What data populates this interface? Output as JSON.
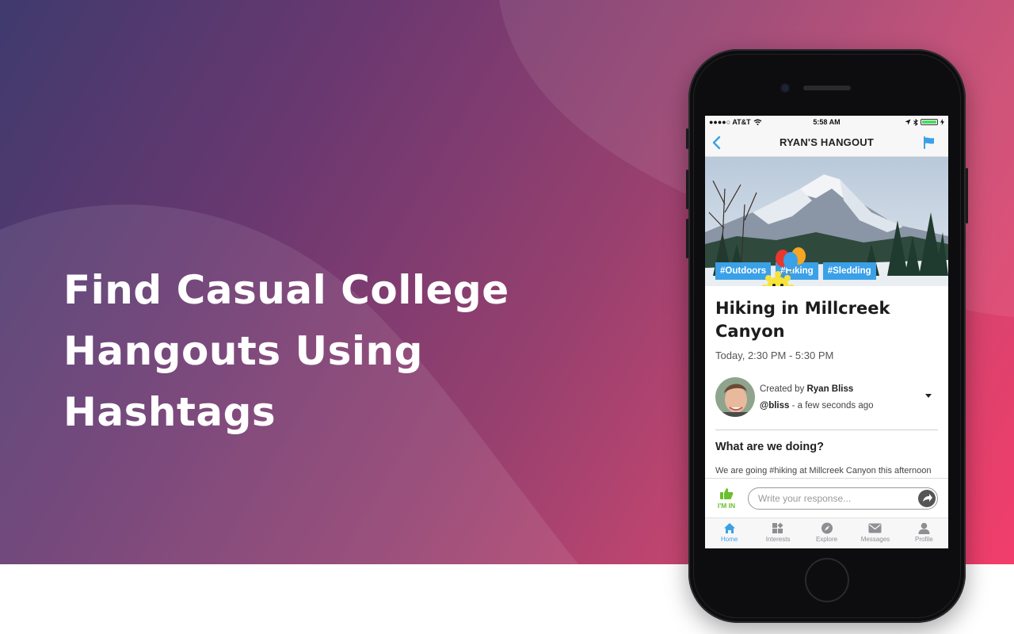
{
  "hero": {
    "headline_lines": [
      "Find Casual College",
      "Hangouts Using",
      "Hashtags"
    ]
  },
  "status": {
    "carrier": "●●●●○ AT&T",
    "time": "5:58 AM"
  },
  "nav": {
    "title": "RYAN'S HANGOUT",
    "back_icon": "chevron-left-icon",
    "flag_icon": "flag-icon"
  },
  "banner": {
    "tags": [
      "#Outdoors",
      "#Hiking",
      "#Sledding"
    ]
  },
  "event": {
    "title": "Hiking in Millcreek Canyon",
    "time": "Today, 2:30 PM - 5:30 PM"
  },
  "creator": {
    "created_by_label": "Created by",
    "name": "Ryan Bliss",
    "handle": "@bliss",
    "ago": " - a few seconds ago"
  },
  "details": {
    "section_title": "What are we doing?",
    "description": "We are going #hiking at Millcreek Canyon this afternoon and hopefully see some wildlife!"
  },
  "response": {
    "imin_label": "I'M IN",
    "placeholder": "Write your response..."
  },
  "tabs": [
    {
      "label": "Home",
      "icon": "home-icon",
      "active": true
    },
    {
      "label": "Interests",
      "icon": "interests-icon",
      "active": false
    },
    {
      "label": "Explore",
      "icon": "compass-icon",
      "active": false
    },
    {
      "label": "Messages",
      "icon": "envelope-icon",
      "active": false
    },
    {
      "label": "Profile",
      "icon": "person-icon",
      "active": false
    }
  ],
  "colors": {
    "accent": "#3aa0e8",
    "imin_green": "#6abf2e",
    "gradient_start": "#3f3a6e",
    "gradient_end": "#f23d6b"
  }
}
